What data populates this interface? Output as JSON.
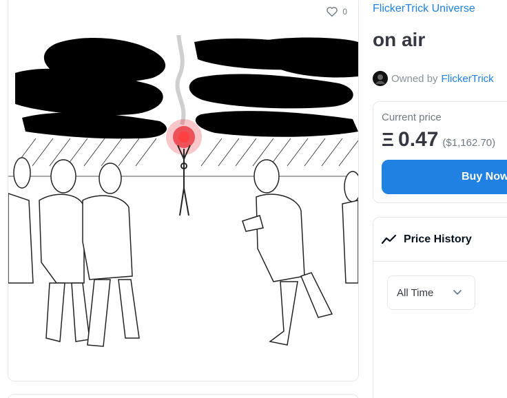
{
  "asset": {
    "favorites_count": "0",
    "collection_name": "FlickerTrick Universe",
    "title": "on air",
    "owner_prefix": "Owned by",
    "owner_name": "FlickerTrick"
  },
  "price": {
    "label": "Current price",
    "currency_symbol": "Ξ",
    "amount": "0.47",
    "usd": "($1,162.70)",
    "buy_label": "Buy Now"
  },
  "price_history": {
    "title": "Price History",
    "range_selected": "All Time"
  },
  "colors": {
    "accent": "#2081e2",
    "text": "#353840",
    "muted": "#707a83",
    "border": "#e5e8eb",
    "flare": "#e8202a"
  },
  "icons": {
    "favorite": "heart-icon",
    "history": "trend-line-icon",
    "dropdown": "chevron-down-icon"
  }
}
